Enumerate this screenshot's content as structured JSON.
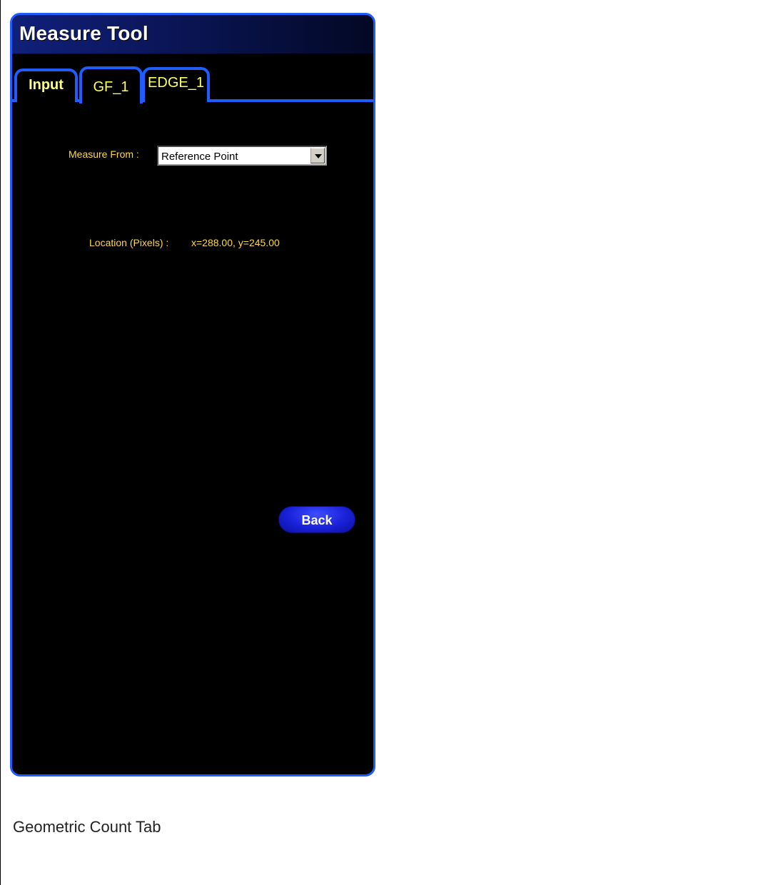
{
  "window": {
    "title": "Measure Tool"
  },
  "tabs": [
    {
      "label": "Input"
    },
    {
      "label": "GF_1",
      "active": true
    },
    {
      "label": "EDGE_1"
    }
  ],
  "measure_from": {
    "label": "Measure From :",
    "selected": "Reference Point"
  },
  "location": {
    "label": "Location (Pixels) :",
    "value": "x=288.00, y=245.00"
  },
  "buttons": {
    "back": "Back"
  },
  "caption": "Geometric Count Tab",
  "colors": {
    "panel_background": "#000000",
    "accent_blue": "#1f5dff",
    "label_yellow": "#ffd84a"
  }
}
